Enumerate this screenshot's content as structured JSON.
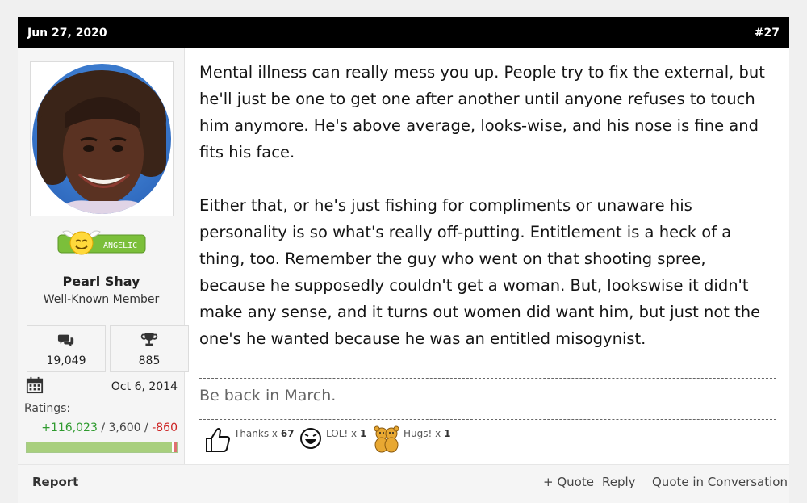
{
  "post": {
    "date": "Jun 27, 2020",
    "number": "#27"
  },
  "user": {
    "name": "Pearl Shay",
    "title": "Well-Known Member",
    "badge_text": "ANGELIC",
    "messages": "19,049",
    "reaction_score": "885",
    "joined": "Oct 6, 2014",
    "ratings_label": "Ratings:",
    "ratings_positive": "+116,023",
    "ratings_neutral": "3,600",
    "ratings_negative": "-860",
    "ratings_sep": "/",
    "ratings_positive_fraction": 0.97
  },
  "content": {
    "paragraphs": [
      "Mental illness can really mess you up. People try to fix the external, but he'll just be one to get one after another until anyone refuses to touch him anymore. He's above average, looks-wise, and his nose is fine and fits his face.",
      "Either that, or he's just fishing for compliments or unaware his personality is so what's really off-putting. Entitlement is a heck of a thing, too. Remember the guy who went on that shooting spree, because he supposedly couldn't get a woman. But, lookswise it didn't make any sense, and it turns out women did want him, but just not the one's he wanted because he was an entitled misogynist."
    ],
    "signature": "Be back in March."
  },
  "reactions": [
    {
      "label": "Thanks x",
      "count": "67",
      "icon": "thumbs-up-icon"
    },
    {
      "label": "LOL! x",
      "count": "1",
      "icon": "laughing-face-icon"
    },
    {
      "label": "Hugs! x",
      "count": "1",
      "icon": "hugging-bears-icon"
    }
  ],
  "footer": {
    "report": "Report",
    "quote": "+ Quote",
    "reply": "Reply",
    "quote_in_conversation": "Quote in Conversation"
  },
  "colors": {
    "header_bg": "#000000",
    "positive": "#2e9a2e",
    "negative": "#cc2222"
  }
}
